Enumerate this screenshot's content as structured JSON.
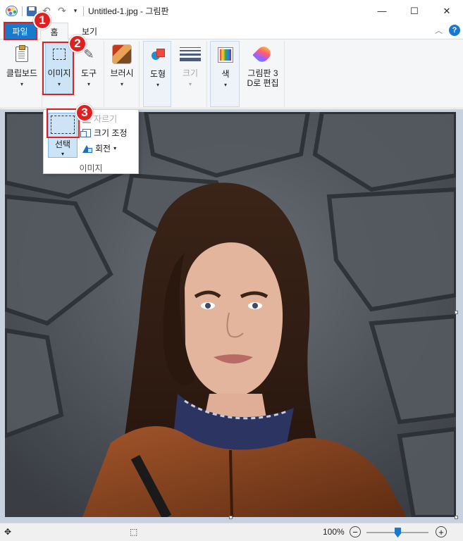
{
  "titlebar": {
    "title": "Untitled-1.jpg - 그림판",
    "minimize": "—",
    "maximize": "☐",
    "close": "✕",
    "undo_glyph": "↶",
    "redo_glyph": "↷",
    "customize_glyph": "▾"
  },
  "tabs": {
    "file": "파일",
    "home": "홈",
    "view": "보기",
    "collapse_glyph": "︿",
    "help": "?"
  },
  "ribbon": {
    "clipboard": "클립보드",
    "image": "이미지",
    "tools": "도구",
    "brushes": "브러시",
    "shapes": "도형",
    "size": "크기",
    "colors": "색",
    "paint3d_line1": "그림판 3",
    "paint3d_line2": "D로 편집",
    "caret": "▾"
  },
  "image_dropdown": {
    "select": "선택",
    "crop": "자르기",
    "resize": "크기 조정",
    "rotate": "회전",
    "rotate_caret": "▾",
    "group_label": "이미지"
  },
  "steps": [
    "1",
    "2",
    "3"
  ],
  "statusbar": {
    "move_glyph": "✥",
    "select_glyph": "⬚",
    "zoom": "100%",
    "zoom_out": "−",
    "zoom_in": "+",
    "zoom_level": 0.5
  },
  "colors": {
    "accent": "#1979ca",
    "highlight": "#e02020",
    "canvas_bg": "#c8d1e0"
  }
}
